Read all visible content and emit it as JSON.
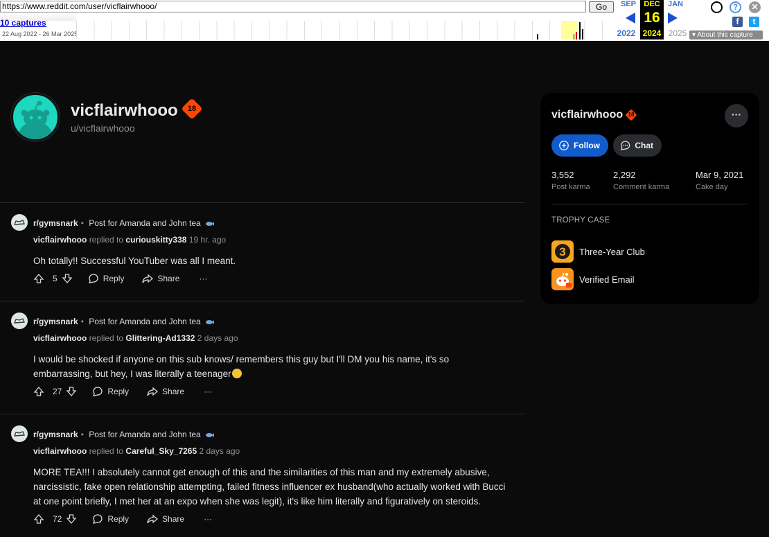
{
  "wayback": {
    "url": "https://www.reddit.com/user/vicflairwhooo/",
    "go_label": "Go",
    "captures_label": "10 captures",
    "date_range": "22 Aug 2022 - 26 Mar 2025",
    "months": {
      "prev": "SEP",
      "current": "DEC",
      "next": "JAN"
    },
    "day": "16",
    "years": {
      "prev": "2022",
      "current": "2024",
      "next": "2025"
    },
    "about_label": "About this capture"
  },
  "profile": {
    "name": "vicflairwhooo",
    "nsfw_badge": "18",
    "username": "u/vicflairwhooo"
  },
  "comments": [
    {
      "subreddit": "r/gymsnark",
      "post": "Post for Amanda and John tea",
      "author": "vicflairwhooo",
      "replied_to_label": "replied to",
      "replied_to": "curiouskitty338",
      "time": "19 hr. ago",
      "text": "Oh totally!! Successful YouTuber was all I meant.",
      "votes": "5",
      "reply_label": "Reply",
      "share_label": "Share",
      "more_label": "···"
    },
    {
      "subreddit": "r/gymsnark",
      "post": "Post for Amanda and John tea",
      "author": "vicflairwhooo",
      "replied_to_label": "replied to",
      "replied_to": "Glittering-Ad1332",
      "time": "2 days ago",
      "text": "I would be shocked if anyone on this sub knows/ remembers this guy but I'll DM you his name, it's so embarrassing, but hey, I was literally a teenager",
      "votes": "27",
      "reply_label": "Reply",
      "share_label": "Share",
      "more_label": "···"
    },
    {
      "subreddit": "r/gymsnark",
      "post": "Post for Amanda and John tea",
      "author": "vicflairwhooo",
      "replied_to_label": "replied to",
      "replied_to": "Careful_Sky_7265",
      "time": "2 days ago",
      "text": "MORE TEA!!! I absolutely cannot get enough of this and the similarities of this man and my extremely abusive, narcissistic, fake open relationship attempting, failed fitness influencer ex husband(who actually worked with Bucci at one point briefly, I met her at an expo when she was legit), it's like him literally and figuratively on steroids.",
      "votes": "72",
      "reply_label": "Reply",
      "share_label": "Share",
      "more_label": "···"
    }
  ],
  "sidebar": {
    "name": "vicflairwhooo",
    "more_label": "···",
    "follow_label": "Follow",
    "chat_label": "Chat",
    "stats": [
      {
        "value": "3,552",
        "label": "Post karma"
      },
      {
        "value": "2,292",
        "label": "Comment karma"
      },
      {
        "value": "Mar 9, 2021",
        "label": "Cake day"
      }
    ],
    "trophy_heading": "TROPHY CASE",
    "trophies": [
      {
        "label": "Three-Year Club"
      },
      {
        "label": "Verified Email"
      }
    ]
  },
  "colors": {
    "background": "#0b0b0c",
    "accent_blue": "#115bca",
    "nsfw": "#ff4500",
    "avatar": "#1ed7c0"
  }
}
